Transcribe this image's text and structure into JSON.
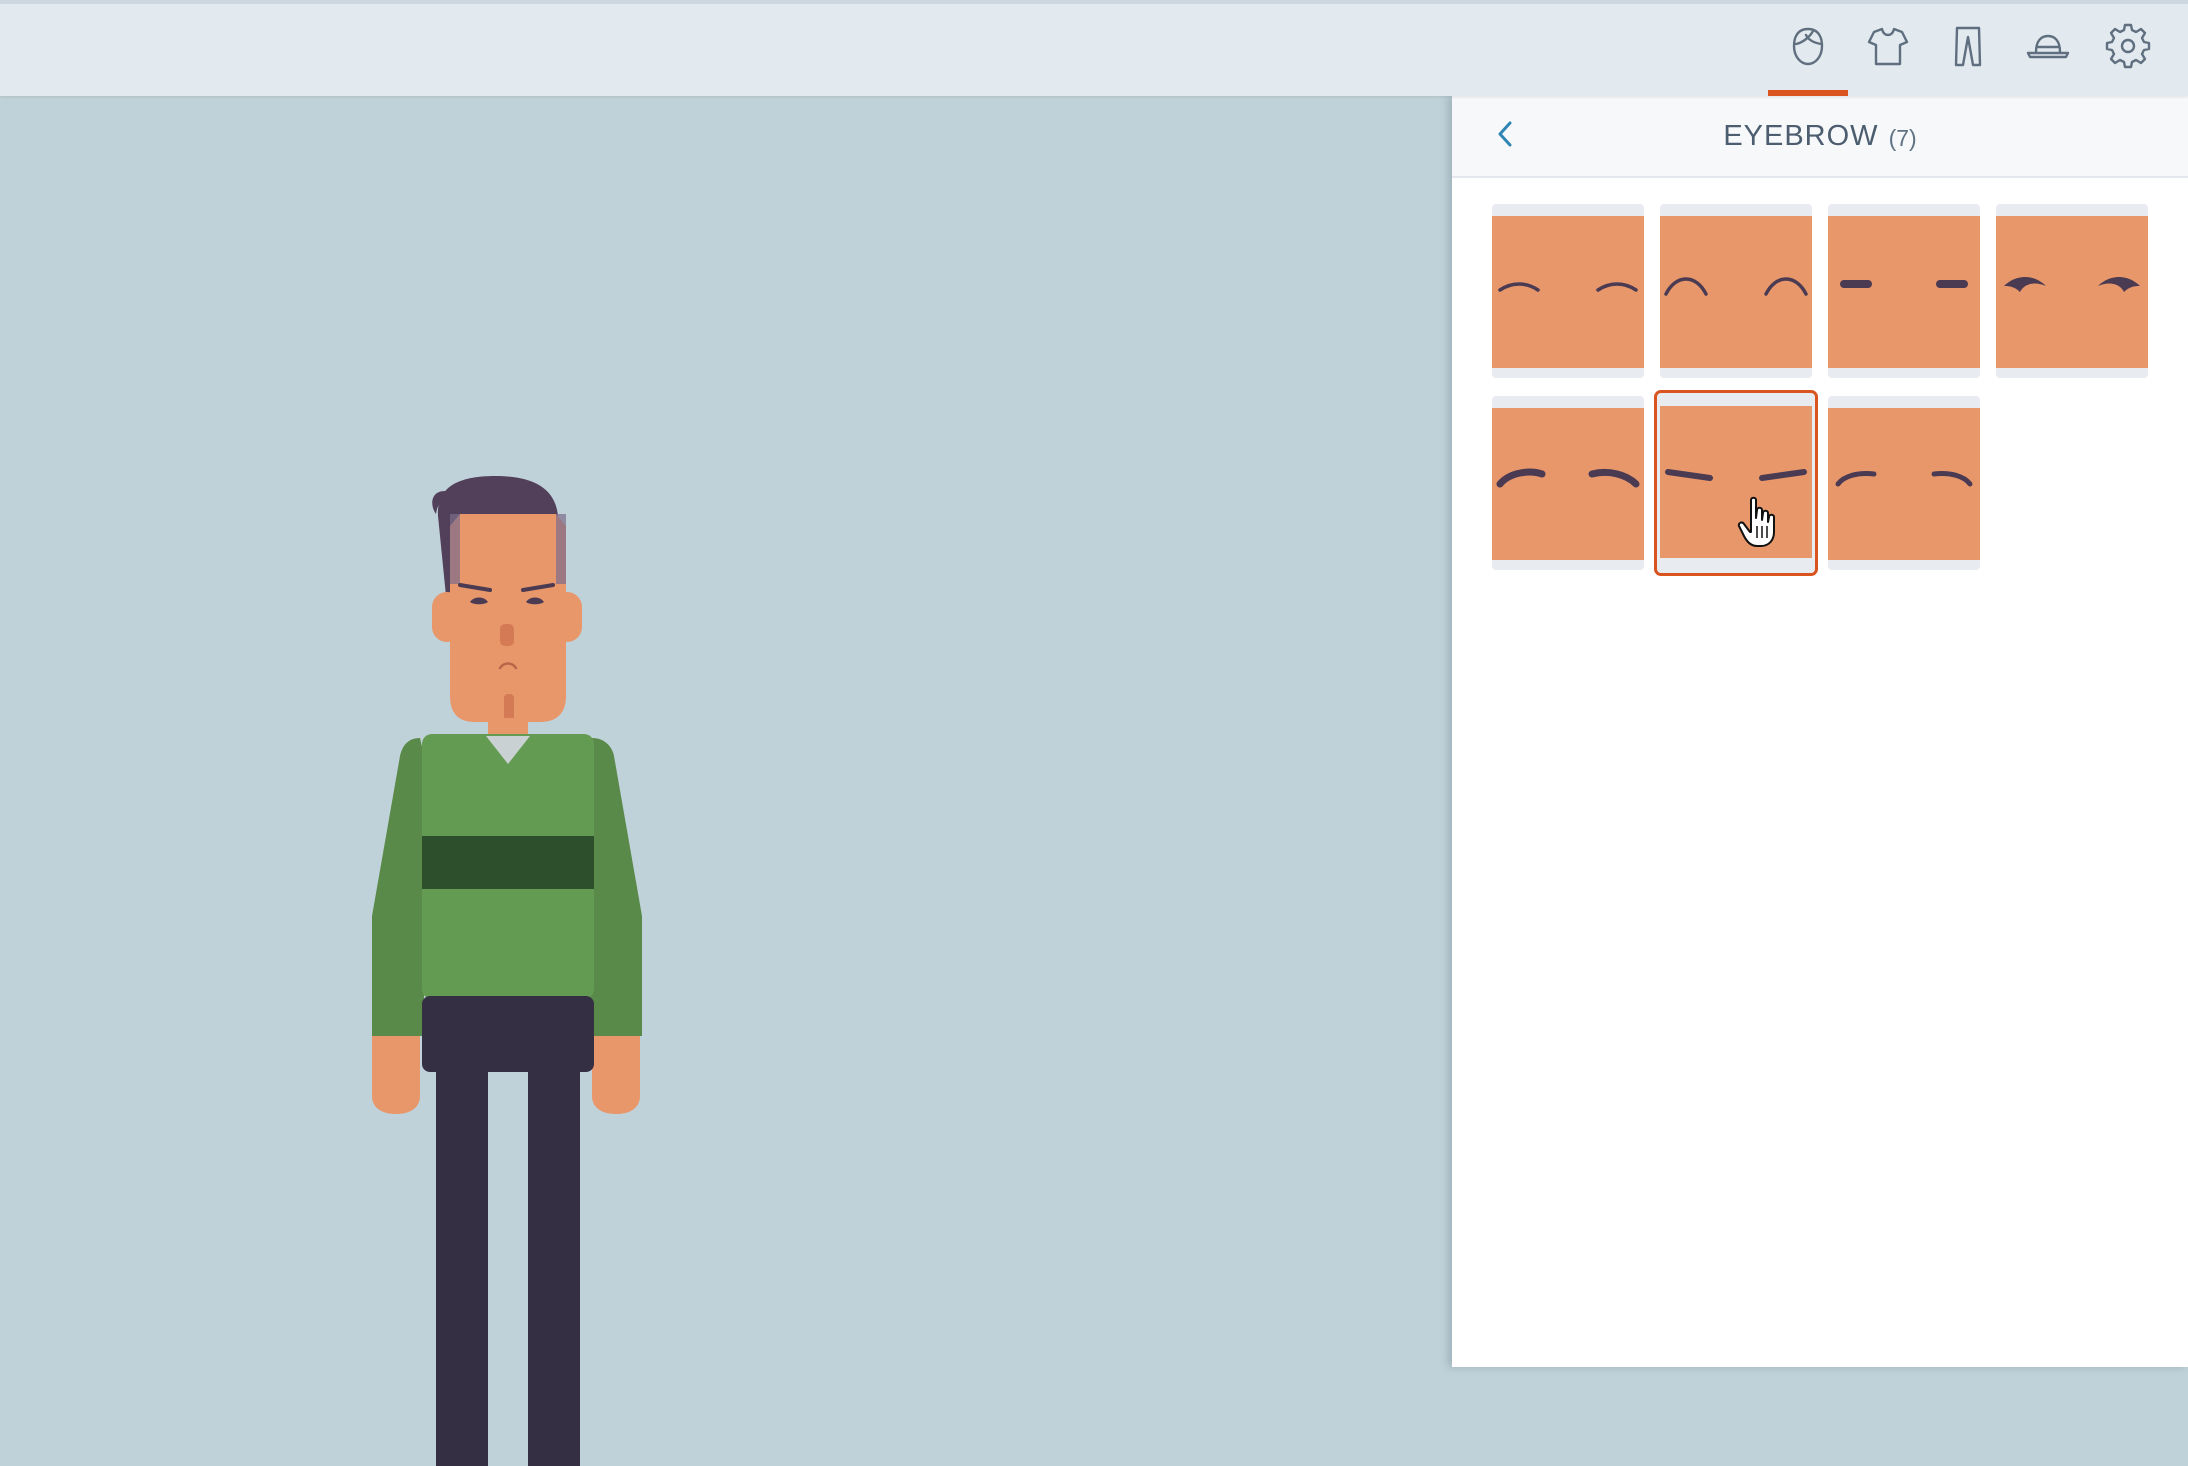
{
  "toolbar": {
    "tabs": [
      {
        "name": "face-tab",
        "icon": "face-icon",
        "active": true
      },
      {
        "name": "shirt-tab",
        "icon": "shirt-icon",
        "active": false
      },
      {
        "name": "pants-tab",
        "icon": "pants-icon",
        "active": false
      },
      {
        "name": "hat-tab",
        "icon": "hat-icon",
        "active": false
      },
      {
        "name": "settings-tab",
        "icon": "gear-icon",
        "active": false
      }
    ],
    "accent_color": "#d9541f"
  },
  "panel": {
    "title": "EYEBROW",
    "count": "(7)",
    "back_icon": "chevron-left-icon",
    "selected_index": 5,
    "options": [
      {
        "style": "thin-arc"
      },
      {
        "style": "high-arc"
      },
      {
        "style": "flat-dash"
      },
      {
        "style": "thick-arc"
      },
      {
        "style": "bold-curve"
      },
      {
        "style": "angled"
      },
      {
        "style": "hooked"
      }
    ]
  },
  "colors": {
    "skin": "#e8976b",
    "brow": "#4a3a52",
    "hair": "#52405a",
    "shirt": "#649b52",
    "belt": "#2e4f2c",
    "pants": "#352f43",
    "canvas": "#c0d2d9"
  }
}
